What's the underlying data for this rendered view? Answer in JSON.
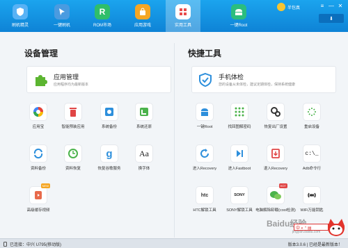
{
  "nav": {
    "items": [
      {
        "label": "刷机精灵",
        "glyph": "",
        "color": "#5cb6ff"
      },
      {
        "label": "一键刷机",
        "glyph": "",
        "color": "#4a9be0"
      },
      {
        "label": "ROM市场",
        "glyph": "R",
        "color": "#2fbe6a"
      },
      {
        "label": "应用游戏",
        "glyph": "",
        "color": "#f5a623"
      },
      {
        "label": "实用工具",
        "glyph": "",
        "color": "#e84b4b"
      },
      {
        "label": "一键Root",
        "glyph": "",
        "color": "#2bbd7e"
      }
    ],
    "user_name": "半包真",
    "download_label": "⬇"
  },
  "left": {
    "title": "设备管理",
    "feature": {
      "title": "应用管理",
      "sub": "应用程序均为最新版本"
    },
    "tools": [
      {
        "label": "应用宝",
        "icon": "yyb-icon"
      },
      {
        "label": "智能预装应用",
        "icon": "trash-icon"
      },
      {
        "label": "系统备份",
        "icon": "backup-icon"
      },
      {
        "label": "系统还原",
        "icon": "restore-icon"
      },
      {
        "label": "资料备份",
        "icon": "sync-icon"
      },
      {
        "label": "资料恢复",
        "icon": "clock-icon"
      },
      {
        "label": "恢复谷歌服务",
        "icon": "google-icon"
      },
      {
        "label": "换字体",
        "icon": "font-icon",
        "glyph": "Aa"
      },
      {
        "label": "高级缓存视频",
        "icon": "video-icon",
        "badge": "NEW"
      }
    ]
  },
  "right": {
    "title": "快捷工具",
    "feature": {
      "title": "手机体检",
      "sub": "您的设备从未体检，建议定期体检，保持系统健康"
    },
    "tools": [
      {
        "label": "一键Root",
        "icon": "android-icon"
      },
      {
        "label": "找回图解密码",
        "icon": "pattern-lock-icon"
      },
      {
        "label": "恢复出厂设置",
        "icon": "gears-icon"
      },
      {
        "label": "重启设备",
        "icon": "reboot-icon"
      },
      {
        "label": "进入Recovery",
        "icon": "refresh-icon"
      },
      {
        "label": "进入Fastboot",
        "icon": "fastboot-icon"
      },
      {
        "label": "退入Recovery",
        "icon": "recovery-box-icon"
      },
      {
        "label": "Adb命令行",
        "icon": "terminal-icon",
        "glyph": "c:\\_"
      },
      {
        "label": "HTC解锁工具",
        "icon": "htc-icon",
        "glyph": "htc"
      },
      {
        "label": "SONY解锁工具",
        "icon": "sony-icon",
        "glyph": "SONY"
      },
      {
        "label": "电脑解除卸载(cool检测)",
        "icon": "wechat-icon",
        "badge": "HOT"
      },
      {
        "label": "WiFi万能钥匙",
        "icon": "wifi-icon"
      }
    ]
  },
  "status": {
    "left": "已连接：中兴 U795(移动版)",
    "right": "版本3.0.6 | 已经是最新版本！"
  },
  "watermark": {
    "text": "Baidu经验",
    "sub": "jingyan.baidu.com"
  },
  "ime": {
    "text": "中 ◐ ° ▤"
  }
}
